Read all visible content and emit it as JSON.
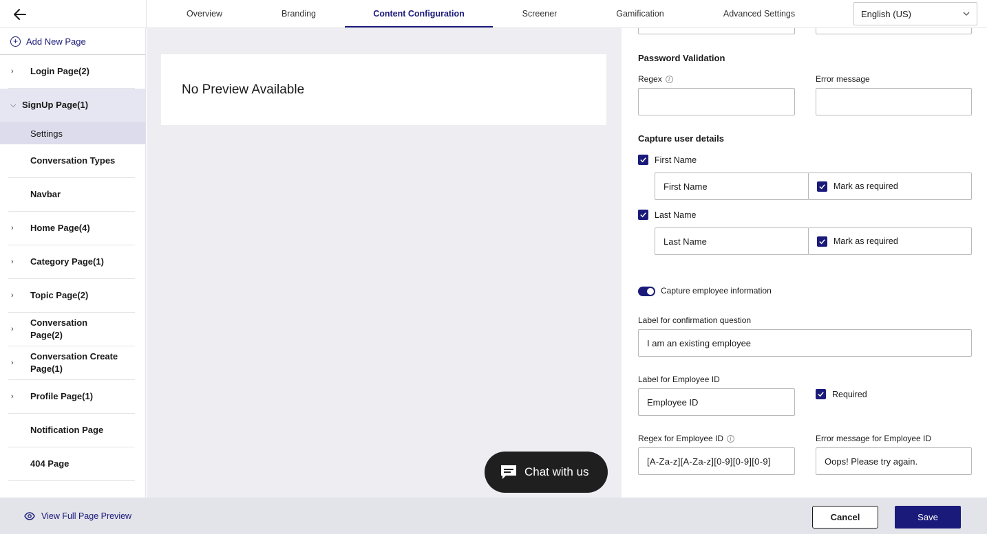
{
  "header": {
    "back_icon": "arrow-left-icon",
    "tabs": [
      {
        "label": "Overview"
      },
      {
        "label": "Branding"
      },
      {
        "label": "Content Configuration",
        "active": true
      },
      {
        "label": "Screener"
      },
      {
        "label": "Gamification"
      },
      {
        "label": "Advanced Settings"
      }
    ],
    "language": "English (US)"
  },
  "sidebar": {
    "add_label": "Add New Page",
    "items": [
      {
        "label": "Login Page(2)",
        "chevron": "›"
      },
      {
        "label": "SignUp Page(1)",
        "chevron": "⌄",
        "expanded": true
      },
      {
        "label": "Conversation Types"
      },
      {
        "label": "Navbar"
      },
      {
        "label": "Home Page(4)",
        "chevron": "›"
      },
      {
        "label": "Category Page(1)",
        "chevron": "›"
      },
      {
        "label": "Topic Page(2)",
        "chevron": "›"
      },
      {
        "label": "Conversation Page(2)",
        "chevron": "›"
      },
      {
        "label": "Conversation Create Page(1)",
        "chevron": "›"
      },
      {
        "label": "Profile Page(1)",
        "chevron": "›"
      },
      {
        "label": "Notification Page"
      },
      {
        "label": "404 Page"
      }
    ],
    "sub_item": "Settings"
  },
  "preview": {
    "message": "No Preview Available",
    "chat_label": "Chat with us"
  },
  "form": {
    "password_validation_title": "Password Validation",
    "regex_label": "Regex",
    "error_message_label": "Error message",
    "regex_value": "",
    "error_message_value": "",
    "capture_title": "Capture user details",
    "first_name_check": "First Name",
    "first_name_value": "First Name",
    "last_name_check": "Last Name",
    "last_name_value": "Last Name",
    "mark_required": "Mark as required",
    "capture_employee_label": "Capture employee information",
    "confirmation_label": "Label for confirmation question",
    "confirmation_value": "I am an existing employee",
    "employee_id_label": "Label for Employee ID",
    "employee_id_value": "Employee ID",
    "required_label": "Required",
    "regex_employee_label": "Regex for Employee ID",
    "regex_employee_value": "[A-Za-z][A-Za-z][0-9][0-9][0-9]",
    "error_employee_label": "Error message for Employee ID",
    "error_employee_value": "Oops! Please try again."
  },
  "footer": {
    "view_preview_label": "View Full Page Preview",
    "cancel_label": "Cancel",
    "save_label": "Save"
  },
  "colors": {
    "accent": "#1a1a7a",
    "sidebar_selected": "#e6e6f2",
    "preview_bg": "#ededf2",
    "bottom_bar": "#e3e3ea"
  }
}
